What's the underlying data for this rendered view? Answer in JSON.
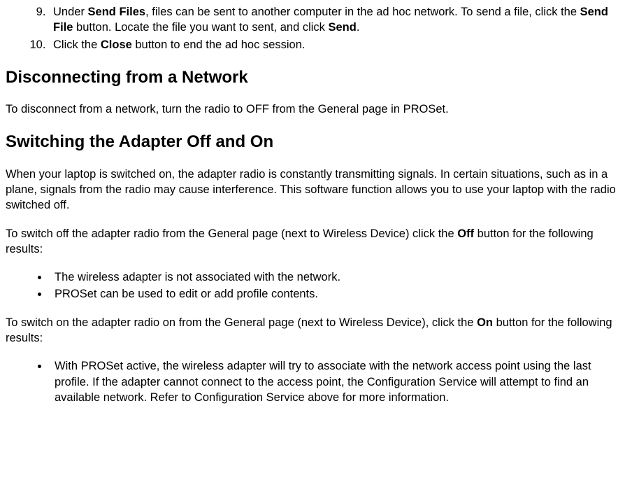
{
  "topList": {
    "start": 9,
    "item9": {
      "pre": "Under ",
      "b1": "Send Files",
      "mid1": ", files can be sent to another computer in the ad hoc network. To send a file, click the ",
      "b2": "Send File",
      "mid2": " button. Locate the file you want to sent, and click ",
      "b3": "Send",
      "post": "."
    },
    "item10": {
      "pre": "Click the ",
      "b1": "Close",
      "post": " button to end the ad hoc session."
    }
  },
  "h_disconnect": "Disconnecting from a Network",
  "p_disconnect": "To disconnect from a network, turn the radio to OFF from the General page in PROSet.",
  "h_switch": "Switching the Adapter Off and On",
  "p_switch_intro": "When your laptop is switched on, the adapter radio is constantly transmitting signals. In certain situations, such as in a plane, signals from the radio may cause interference. This software function allows you to use your laptop with the radio switched off.",
  "p_off": {
    "pre": "To switch off the adapter radio from the General page (next to Wireless Device) click the ",
    "b": "Off",
    "post": " button for the following results:"
  },
  "off_bullets": {
    "b1": "The wireless adapter is not associated with the network.",
    "b2": "PROSet can be used to edit or add profile contents."
  },
  "p_on": {
    "pre": "To switch on the adapter radio on from the General page (next to Wireless Device), click the ",
    "b": "On",
    "post": " button for the following results:"
  },
  "on_bullets": {
    "b1": "With PROSet active, the wireless adapter will try to associate with the network access point using the last profile. If the adapter cannot connect to the access point, the Configuration Service will attempt to find an available network. Refer to Configuration Service above for more information."
  }
}
